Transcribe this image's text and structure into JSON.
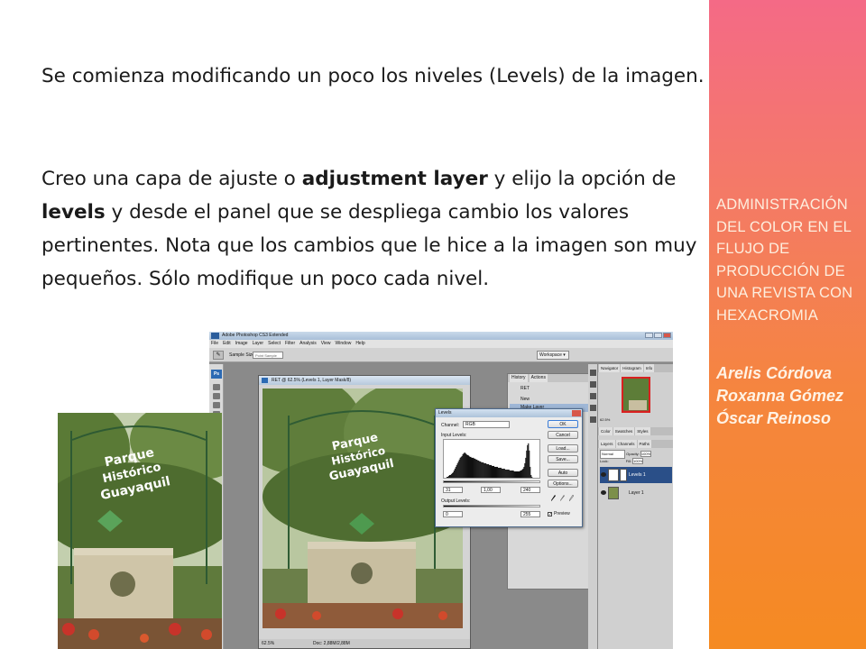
{
  "slide": {
    "paragraph1": "Se comienza modificando un poco los niveles (Levels) de la imagen.",
    "paragraph2": {
      "t1": "Creo una capa de ajuste o ",
      "b1": "adjustment layer",
      "t2": " y elijo la opción de ",
      "b2": "levels",
      "t3": " y desde el panel que se despliega cambio los valores pertinentes. Nota que los cambios que le hice a la imagen son muy pequeños. Sólo modifique un poco cada nivel."
    }
  },
  "sidebar": {
    "title_lines": [
      "ADMINISTRACIÓN",
      "DEL COLOR EN EL",
      "FLUJO DE",
      "PRODUCCIÓN DE",
      "UNA REVISTA CON",
      "HEXACROMIA"
    ],
    "authors": [
      "Arelis Córdova",
      "Roxanna Gómez",
      "Óscar Reinoso"
    ],
    "colors": {
      "top": "#f46a86",
      "bottom": "#f58a22"
    }
  },
  "photoshop": {
    "app_title": "Adobe Photoshop CS3 Extended",
    "menu": [
      "File",
      "Edit",
      "Image",
      "Layer",
      "Select",
      "Filter",
      "Analysis",
      "View",
      "Window",
      "Help"
    ],
    "options": {
      "sample_size_label": "Sample Size:",
      "sample_size_value": "Point Sample",
      "workspace": "Workspace ▾"
    },
    "toolbox_logo": "Ps",
    "document": {
      "title": "RET @ 62.5% (Levels 1, Layer Mask/8)",
      "zoom": "62.5%",
      "doc_info": "Doc: 2,88M/2,88M"
    },
    "photo_sign": [
      "Parque",
      "Histórico",
      "Guayaquil"
    ],
    "levels": {
      "title": "Levels",
      "channel_label": "Channel:",
      "channel_value": "RGB",
      "input_label": "Input Levels:",
      "input_values": [
        "31",
        "1,00",
        "240"
      ],
      "output_label": "Output Levels:",
      "output_values": [
        "0",
        "255"
      ],
      "buttons": [
        "OK",
        "Cancel",
        "Load...",
        "Save...",
        "Auto",
        "Options..."
      ],
      "preview_label": "Preview",
      "preview_checked": true,
      "histogram": [
        0,
        0,
        0,
        1,
        1,
        2,
        3,
        3,
        4,
        5,
        6,
        8,
        10,
        12,
        14,
        16,
        18,
        20,
        22,
        23,
        24,
        26,
        27,
        28,
        27,
        26,
        25,
        25,
        24,
        23,
        23,
        22,
        22,
        22,
        21,
        21,
        20,
        20,
        19,
        19,
        18,
        18,
        17,
        17,
        17,
        16,
        16,
        16,
        15,
        15,
        15,
        14,
        14,
        14,
        13,
        13,
        13,
        12,
        12,
        12,
        12,
        11,
        11,
        11,
        11,
        10,
        10,
        10,
        10,
        9,
        9,
        9,
        9,
        9,
        8,
        8,
        8,
        8,
        8,
        7,
        7,
        7,
        7,
        7,
        7,
        7,
        8,
        8,
        9,
        10,
        12,
        16,
        22,
        30,
        36,
        38,
        30,
        12,
        3,
        1,
        0,
        0,
        0,
        0,
        0,
        0,
        0,
        0
      ]
    },
    "history": {
      "tabs": [
        "History",
        "Actions"
      ],
      "items": [
        "RET",
        "New",
        "Make Layer"
      ]
    },
    "navigator": {
      "tabs": [
        "Navigator",
        "Histogram",
        "Info"
      ],
      "zoom": "62.5%"
    },
    "color_tabs": [
      "Color",
      "Swatches",
      "Styles"
    ],
    "layers": {
      "tabs": [
        "Layers",
        "Channels",
        "Paths"
      ],
      "blend_mode": "Normal",
      "opacity_label": "Opacity:",
      "opacity_value": "100%",
      "fill_label": "Fill:",
      "fill_value": "100%",
      "lock_label": "Lock:",
      "items": [
        "Levels 1",
        "Layer 1"
      ]
    }
  }
}
